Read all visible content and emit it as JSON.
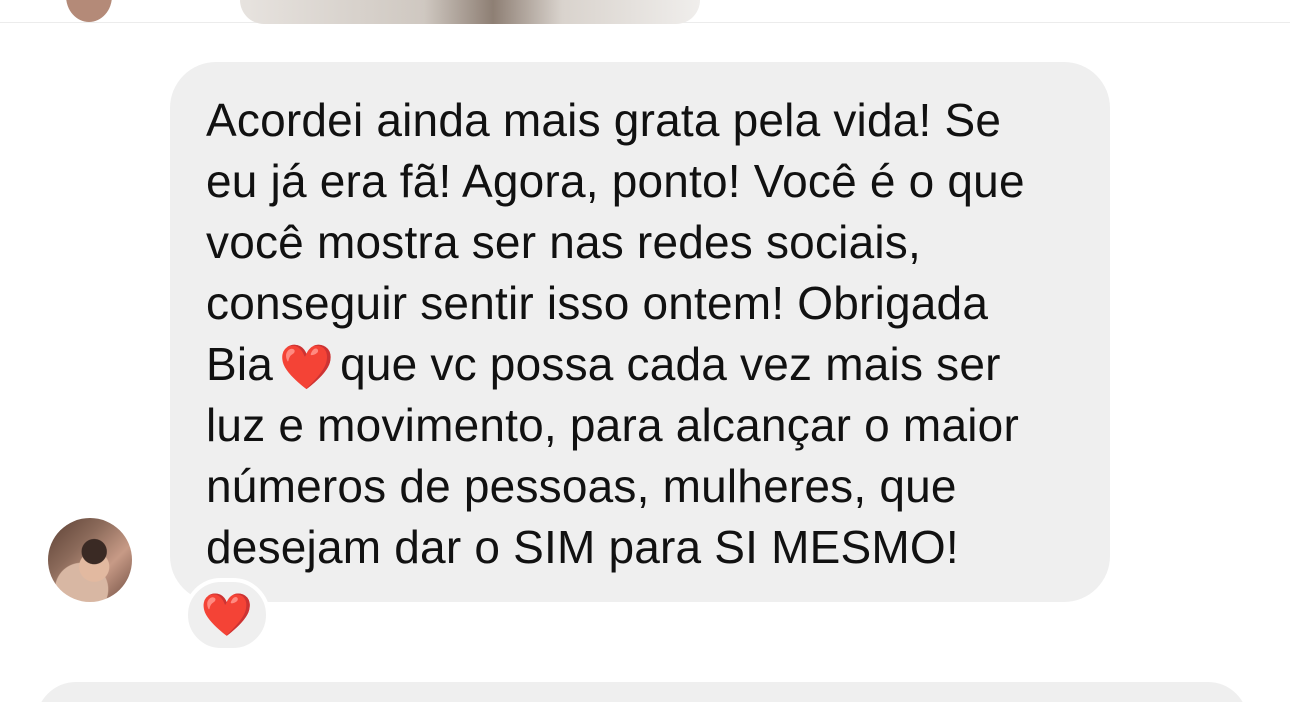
{
  "thread": {
    "message": {
      "lines": [
        "Acordei ainda mais grata pela vida! Se",
        "eu já era fã! Agora, ponto! Você é o que",
        "você mostra ser nas redes sociais,",
        "conseguir sentir isso ontem! Obrigada",
        "Bia",
        "que vc possa cada vez mais ser",
        "luz e movimento, para alcançar o maior",
        "números de pessoas, mulheres, que",
        "desejam dar o SIM para SI MESMO!"
      ],
      "inline_emoji": "❤️"
    },
    "reaction": {
      "emoji": "❤️"
    }
  },
  "colors": {
    "bubble": "#efefef",
    "text": "#111111",
    "heart": "#f0202b"
  },
  "icons": {
    "inline": "red-heart-icon",
    "reaction": "red-heart-icon"
  }
}
